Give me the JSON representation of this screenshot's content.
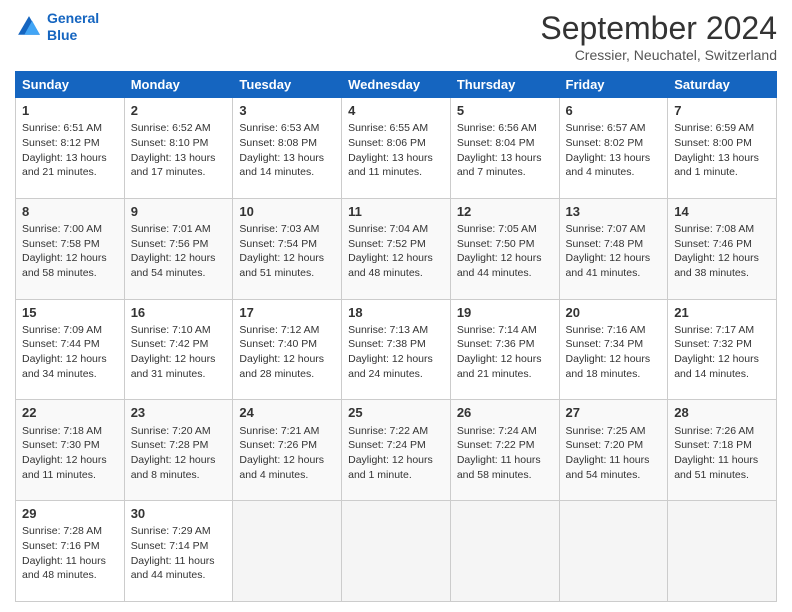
{
  "header": {
    "logo_line1": "General",
    "logo_line2": "Blue",
    "title": "September 2024",
    "subtitle": "Cressier, Neuchatel, Switzerland"
  },
  "columns": [
    "Sunday",
    "Monday",
    "Tuesday",
    "Wednesday",
    "Thursday",
    "Friday",
    "Saturday"
  ],
  "weeks": [
    [
      {
        "day": "1",
        "lines": [
          "Sunrise: 6:51 AM",
          "Sunset: 8:12 PM",
          "Daylight: 13 hours",
          "and 21 minutes."
        ]
      },
      {
        "day": "2",
        "lines": [
          "Sunrise: 6:52 AM",
          "Sunset: 8:10 PM",
          "Daylight: 13 hours",
          "and 17 minutes."
        ]
      },
      {
        "day": "3",
        "lines": [
          "Sunrise: 6:53 AM",
          "Sunset: 8:08 PM",
          "Daylight: 13 hours",
          "and 14 minutes."
        ]
      },
      {
        "day": "4",
        "lines": [
          "Sunrise: 6:55 AM",
          "Sunset: 8:06 PM",
          "Daylight: 13 hours",
          "and 11 minutes."
        ]
      },
      {
        "day": "5",
        "lines": [
          "Sunrise: 6:56 AM",
          "Sunset: 8:04 PM",
          "Daylight: 13 hours",
          "and 7 minutes."
        ]
      },
      {
        "day": "6",
        "lines": [
          "Sunrise: 6:57 AM",
          "Sunset: 8:02 PM",
          "Daylight: 13 hours",
          "and 4 minutes."
        ]
      },
      {
        "day": "7",
        "lines": [
          "Sunrise: 6:59 AM",
          "Sunset: 8:00 PM",
          "Daylight: 13 hours",
          "and 1 minute."
        ]
      }
    ],
    [
      {
        "day": "8",
        "lines": [
          "Sunrise: 7:00 AM",
          "Sunset: 7:58 PM",
          "Daylight: 12 hours",
          "and 58 minutes."
        ]
      },
      {
        "day": "9",
        "lines": [
          "Sunrise: 7:01 AM",
          "Sunset: 7:56 PM",
          "Daylight: 12 hours",
          "and 54 minutes."
        ]
      },
      {
        "day": "10",
        "lines": [
          "Sunrise: 7:03 AM",
          "Sunset: 7:54 PM",
          "Daylight: 12 hours",
          "and 51 minutes."
        ]
      },
      {
        "day": "11",
        "lines": [
          "Sunrise: 7:04 AM",
          "Sunset: 7:52 PM",
          "Daylight: 12 hours",
          "and 48 minutes."
        ]
      },
      {
        "day": "12",
        "lines": [
          "Sunrise: 7:05 AM",
          "Sunset: 7:50 PM",
          "Daylight: 12 hours",
          "and 44 minutes."
        ]
      },
      {
        "day": "13",
        "lines": [
          "Sunrise: 7:07 AM",
          "Sunset: 7:48 PM",
          "Daylight: 12 hours",
          "and 41 minutes."
        ]
      },
      {
        "day": "14",
        "lines": [
          "Sunrise: 7:08 AM",
          "Sunset: 7:46 PM",
          "Daylight: 12 hours",
          "and 38 minutes."
        ]
      }
    ],
    [
      {
        "day": "15",
        "lines": [
          "Sunrise: 7:09 AM",
          "Sunset: 7:44 PM",
          "Daylight: 12 hours",
          "and 34 minutes."
        ]
      },
      {
        "day": "16",
        "lines": [
          "Sunrise: 7:10 AM",
          "Sunset: 7:42 PM",
          "Daylight: 12 hours",
          "and 31 minutes."
        ]
      },
      {
        "day": "17",
        "lines": [
          "Sunrise: 7:12 AM",
          "Sunset: 7:40 PM",
          "Daylight: 12 hours",
          "and 28 minutes."
        ]
      },
      {
        "day": "18",
        "lines": [
          "Sunrise: 7:13 AM",
          "Sunset: 7:38 PM",
          "Daylight: 12 hours",
          "and 24 minutes."
        ]
      },
      {
        "day": "19",
        "lines": [
          "Sunrise: 7:14 AM",
          "Sunset: 7:36 PM",
          "Daylight: 12 hours",
          "and 21 minutes."
        ]
      },
      {
        "day": "20",
        "lines": [
          "Sunrise: 7:16 AM",
          "Sunset: 7:34 PM",
          "Daylight: 12 hours",
          "and 18 minutes."
        ]
      },
      {
        "day": "21",
        "lines": [
          "Sunrise: 7:17 AM",
          "Sunset: 7:32 PM",
          "Daylight: 12 hours",
          "and 14 minutes."
        ]
      }
    ],
    [
      {
        "day": "22",
        "lines": [
          "Sunrise: 7:18 AM",
          "Sunset: 7:30 PM",
          "Daylight: 12 hours",
          "and 11 minutes."
        ]
      },
      {
        "day": "23",
        "lines": [
          "Sunrise: 7:20 AM",
          "Sunset: 7:28 PM",
          "Daylight: 12 hours",
          "and 8 minutes."
        ]
      },
      {
        "day": "24",
        "lines": [
          "Sunrise: 7:21 AM",
          "Sunset: 7:26 PM",
          "Daylight: 12 hours",
          "and 4 minutes."
        ]
      },
      {
        "day": "25",
        "lines": [
          "Sunrise: 7:22 AM",
          "Sunset: 7:24 PM",
          "Daylight: 12 hours",
          "and 1 minute."
        ]
      },
      {
        "day": "26",
        "lines": [
          "Sunrise: 7:24 AM",
          "Sunset: 7:22 PM",
          "Daylight: 11 hours",
          "and 58 minutes."
        ]
      },
      {
        "day": "27",
        "lines": [
          "Sunrise: 7:25 AM",
          "Sunset: 7:20 PM",
          "Daylight: 11 hours",
          "and 54 minutes."
        ]
      },
      {
        "day": "28",
        "lines": [
          "Sunrise: 7:26 AM",
          "Sunset: 7:18 PM",
          "Daylight: 11 hours",
          "and 51 minutes."
        ]
      }
    ],
    [
      {
        "day": "29",
        "lines": [
          "Sunrise: 7:28 AM",
          "Sunset: 7:16 PM",
          "Daylight: 11 hours",
          "and 48 minutes."
        ]
      },
      {
        "day": "30",
        "lines": [
          "Sunrise: 7:29 AM",
          "Sunset: 7:14 PM",
          "Daylight: 11 hours",
          "and 44 minutes."
        ]
      },
      {
        "day": "",
        "lines": [],
        "empty": true
      },
      {
        "day": "",
        "lines": [],
        "empty": true
      },
      {
        "day": "",
        "lines": [],
        "empty": true
      },
      {
        "day": "",
        "lines": [],
        "empty": true
      },
      {
        "day": "",
        "lines": [],
        "empty": true
      }
    ]
  ]
}
